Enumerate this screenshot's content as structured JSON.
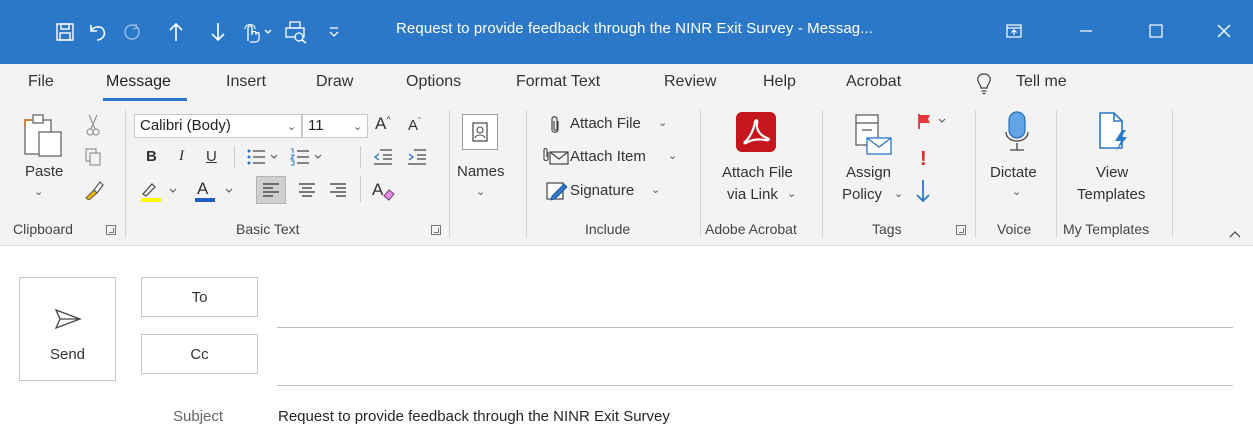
{
  "window": {
    "title": "Request to provide feedback through the NINR Exit Survey  -  Messag...",
    "accent": "#2b78c8"
  },
  "quick_access": [
    "save-icon",
    "undo-icon",
    "redo-icon",
    "previous-item-icon",
    "next-item-icon",
    "touch-mode-icon",
    "print-preview-icon",
    "customize-qat-icon"
  ],
  "tabs": [
    {
      "label": "File"
    },
    {
      "label": "Message",
      "active": true
    },
    {
      "label": "Insert"
    },
    {
      "label": "Draw"
    },
    {
      "label": "Options"
    },
    {
      "label": "Format Text"
    },
    {
      "label": "Review"
    },
    {
      "label": "Help"
    },
    {
      "label": "Acrobat"
    },
    {
      "label": "Tell me"
    }
  ],
  "ribbon": {
    "clipboard": {
      "paste": "Paste",
      "group": "Clipboard"
    },
    "basic_text": {
      "font": "Calibri (Body)",
      "size": "11",
      "bold": "B",
      "italic": "I",
      "underline": "U",
      "group": "Basic Text"
    },
    "names": {
      "label": "Names"
    },
    "include": {
      "attach_file": "Attach File",
      "attach_item": "Attach Item",
      "signature": "Signature",
      "group": "Include"
    },
    "adobe": {
      "line1": "Attach File",
      "line2": "via Link",
      "group": "Adobe Acrobat",
      "brand_color": "#c4161c"
    },
    "tags": {
      "line1": "Assign",
      "line2": "Policy",
      "group": "Tags"
    },
    "voice": {
      "label": "Dictate",
      "group": "Voice"
    },
    "templates": {
      "line1": "View",
      "line2": "Templates",
      "group": "My Templates"
    }
  },
  "compose": {
    "send": "Send",
    "to": "To",
    "to_value": "",
    "cc": "Cc",
    "cc_value": "",
    "subject_label": "Subject",
    "subject_value": "Request to provide feedback through the NINR Exit Survey"
  }
}
